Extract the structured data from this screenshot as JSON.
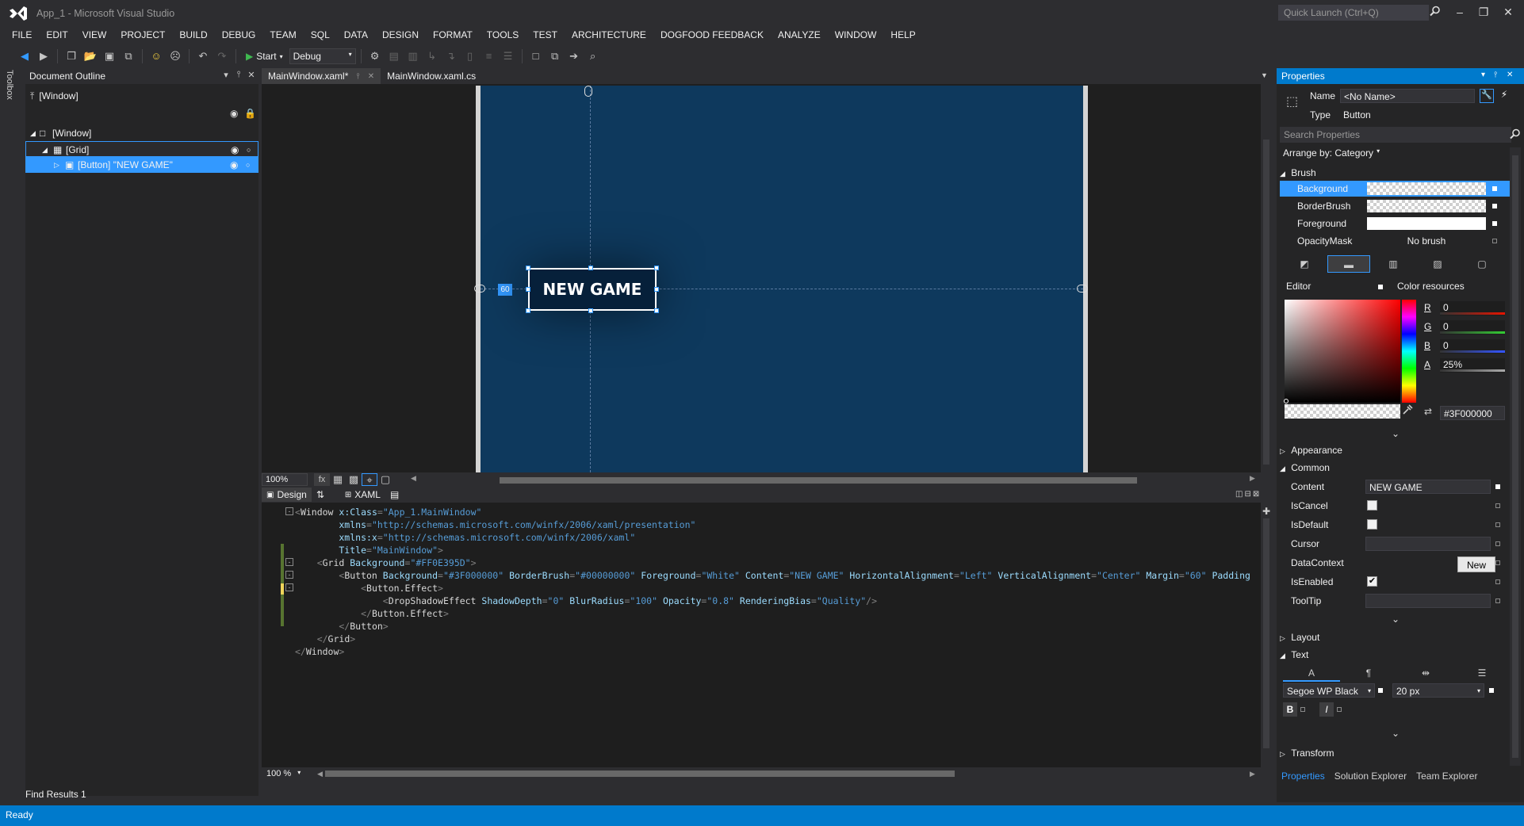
{
  "title_bar": {
    "app_title": "App_1 - Microsoft Visual Studio",
    "quick_launch_placeholder": "Quick Launch (Ctrl+Q)"
  },
  "menu": [
    "FILE",
    "EDIT",
    "VIEW",
    "PROJECT",
    "BUILD",
    "DEBUG",
    "TEAM",
    "SQL",
    "DATA",
    "DESIGN",
    "FORMAT",
    "TOOLS",
    "TEST",
    "ARCHITECTURE",
    "DOGFOOD FEEDBACK",
    "ANALYZE",
    "WINDOW",
    "HELP"
  ],
  "toolbar": {
    "start_label": "Start",
    "configuration": "Debug"
  },
  "toolbox_label": "Toolbox",
  "document_outline": {
    "title": "Document Outline",
    "breadcrumb": "[Window]",
    "tree": [
      {
        "label": "[Window]"
      },
      {
        "label": "[Grid]"
      },
      {
        "label": "[Button] \"NEW GAME\""
      }
    ]
  },
  "doc_tabs": [
    {
      "label": "MainWindow.xaml*"
    },
    {
      "label": "MainWindow.xaml.cs"
    }
  ],
  "designer": {
    "button_content": "NEW GAME",
    "margin_value": "60",
    "zoom": "100%",
    "window_background": "#0e395d"
  },
  "split_tabs": {
    "design": "Design",
    "xaml": "XAML"
  },
  "xaml_lines": [
    [
      [
        "x-tag",
        "<"
      ],
      [
        "x-el",
        "Window "
      ],
      [
        "x-attr",
        "x:Class"
      ],
      [
        "x-tag",
        "="
      ],
      [
        "x-val",
        "\"App_1.MainWindow\""
      ]
    ],
    [
      [
        "x-attr",
        "        xmlns"
      ],
      [
        "x-tag",
        "="
      ],
      [
        "x-val",
        "\"http://schemas.microsoft.com/winfx/2006/xaml/presentation\""
      ]
    ],
    [
      [
        "x-attr",
        "        xmlns:x"
      ],
      [
        "x-tag",
        "="
      ],
      [
        "x-val",
        "\"http://schemas.microsoft.com/winfx/2006/xaml\""
      ]
    ],
    [
      [
        "x-attr",
        "        Title"
      ],
      [
        "x-tag",
        "="
      ],
      [
        "x-val",
        "\"MainWindow\""
      ],
      [
        "x-tag",
        ">"
      ]
    ],
    [
      [
        "x-tag",
        "    <"
      ],
      [
        "x-el",
        "Grid "
      ],
      [
        "x-attr",
        "Background"
      ],
      [
        "x-tag",
        "="
      ],
      [
        "x-val",
        "\"#FF0E395D\""
      ],
      [
        "x-tag",
        ">"
      ]
    ],
    [
      [
        "x-tag",
        "        <"
      ],
      [
        "x-el",
        "Button "
      ],
      [
        "x-attr",
        "Background"
      ],
      [
        "x-tag",
        "="
      ],
      [
        "x-val",
        "\"#3F000000\" "
      ],
      [
        "x-attr",
        "BorderBrush"
      ],
      [
        "x-tag",
        "="
      ],
      [
        "x-val",
        "\"#00000000\" "
      ],
      [
        "x-attr",
        "Foreground"
      ],
      [
        "x-tag",
        "="
      ],
      [
        "x-val",
        "\"White\" "
      ],
      [
        "x-attr",
        "Content"
      ],
      [
        "x-tag",
        "="
      ],
      [
        "x-val",
        "\"NEW GAME\" "
      ],
      [
        "x-attr",
        "HorizontalAlignment"
      ],
      [
        "x-tag",
        "="
      ],
      [
        "x-val",
        "\"Left\" "
      ],
      [
        "x-attr",
        "VerticalAlignment"
      ],
      [
        "x-tag",
        "="
      ],
      [
        "x-val",
        "\"Center\" "
      ],
      [
        "x-attr",
        "Margin"
      ],
      [
        "x-tag",
        "="
      ],
      [
        "x-val",
        "\"60\" "
      ],
      [
        "x-attr",
        "Padding"
      ]
    ],
    [
      [
        "x-tag",
        "            <"
      ],
      [
        "x-el",
        "Button.Effect"
      ],
      [
        "x-tag",
        ">"
      ]
    ],
    [
      [
        "x-tag",
        "                <"
      ],
      [
        "x-el",
        "DropShadowEffect "
      ],
      [
        "x-attr",
        "ShadowDepth"
      ],
      [
        "x-tag",
        "="
      ],
      [
        "x-val",
        "\"0\" "
      ],
      [
        "x-attr",
        "BlurRadius"
      ],
      [
        "x-tag",
        "="
      ],
      [
        "x-val",
        "\"100\" "
      ],
      [
        "x-attr",
        "Opacity"
      ],
      [
        "x-tag",
        "="
      ],
      [
        "x-val",
        "\"0.8\" "
      ],
      [
        "x-attr",
        "RenderingBias"
      ],
      [
        "x-tag",
        "="
      ],
      [
        "x-val",
        "\"Quality\""
      ],
      [
        "x-tag",
        "/>"
      ]
    ],
    [
      [
        "x-tag",
        "            </"
      ],
      [
        "x-el",
        "Button.Effect"
      ],
      [
        "x-tag",
        ">"
      ]
    ],
    [
      [
        "x-tag",
        "        </"
      ],
      [
        "x-el",
        "Button"
      ],
      [
        "x-tag",
        ">"
      ]
    ],
    [
      [
        "x-tag",
        "    </"
      ],
      [
        "x-el",
        "Grid"
      ],
      [
        "x-tag",
        ">"
      ]
    ],
    [
      [
        "x-tag",
        "</"
      ],
      [
        "x-el",
        "Window"
      ],
      [
        "x-tag",
        ">"
      ]
    ]
  ],
  "xaml_zoom": "100 %",
  "find_results": "Find Results 1",
  "status": "Ready",
  "properties": {
    "title": "Properties",
    "name_label": "Name",
    "name_value": "<No Name>",
    "type_label": "Type",
    "type_value": "Button",
    "search_placeholder": "Search Properties",
    "arrange_by": "Arrange by: Category",
    "brush_header": "Brush",
    "brush_rows": [
      {
        "label": "Background"
      },
      {
        "label": "BorderBrush"
      },
      {
        "label": "Foreground"
      },
      {
        "label": "OpacityMask",
        "value": "No brush"
      }
    ],
    "editor_label": "Editor",
    "color_resources_label": "Color resources",
    "rgba": [
      {
        "label": "R",
        "value": "0",
        "color": "#e51400"
      },
      {
        "label": "G",
        "value": "0",
        "color": "#33cc33"
      },
      {
        "label": "B",
        "value": "0",
        "color": "#3355ff"
      },
      {
        "label": "A",
        "value": "25%",
        "color": "#aaaaaa"
      }
    ],
    "hex_value": "#3F000000",
    "appearance_header": "Appearance",
    "common_header": "Common",
    "common": {
      "content_label": "Content",
      "content_value": "NEW GAME",
      "iscancel_label": "IsCancel",
      "isdefault_label": "IsDefault",
      "cursor_label": "Cursor",
      "datacontext_label": "DataContext",
      "new_button": "New",
      "isenabled_label": "IsEnabled",
      "tooltip_label": "ToolTip"
    },
    "layout_header": "Layout",
    "text_header": "Text",
    "font_family": "Segoe WP Black",
    "font_size": "20 px",
    "transform_header": "Transform",
    "bottom_tabs": [
      "Properties",
      "Solution Explorer",
      "Team Explorer"
    ]
  }
}
